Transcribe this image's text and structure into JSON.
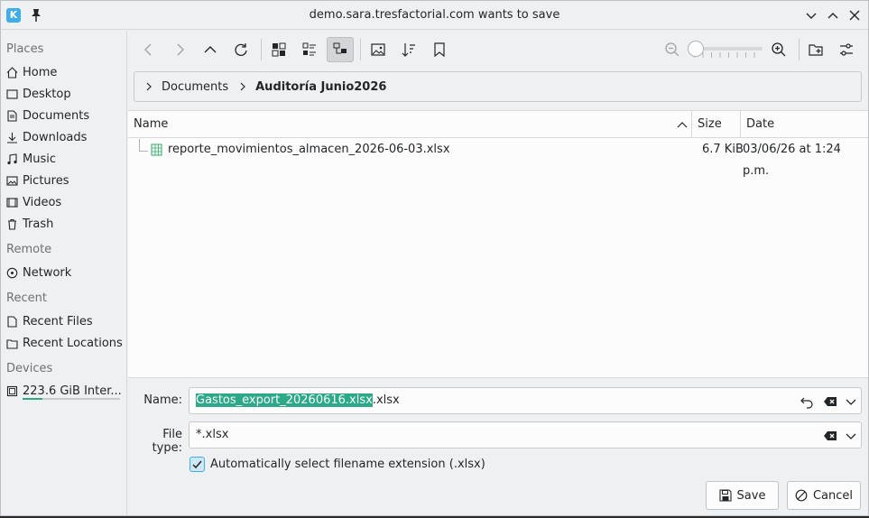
{
  "window": {
    "title": "demo.sara.tresfactorial.com wants to save",
    "app_icon_letter": "K"
  },
  "sidebar": {
    "sections": [
      {
        "title": "Places",
        "items": [
          {
            "label": "Home",
            "icon": "home-icon"
          },
          {
            "label": "Desktop",
            "icon": "desktop-icon"
          },
          {
            "label": "Documents",
            "icon": "documents-icon"
          },
          {
            "label": "Downloads",
            "icon": "downloads-icon"
          },
          {
            "label": "Music",
            "icon": "music-icon"
          },
          {
            "label": "Pictures",
            "icon": "pictures-icon"
          },
          {
            "label": "Videos",
            "icon": "videos-icon"
          },
          {
            "label": "Trash",
            "icon": "trash-icon"
          }
        ]
      },
      {
        "title": "Remote",
        "items": [
          {
            "label": "Network",
            "icon": "network-icon"
          }
        ]
      },
      {
        "title": "Recent",
        "items": [
          {
            "label": "Recent Files",
            "icon": "recent-files-icon"
          },
          {
            "label": "Recent Locations",
            "icon": "recent-locations-icon"
          }
        ]
      },
      {
        "title": "Devices",
        "items": [
          {
            "label": "223.6 GiB Inter...",
            "icon": "drive-icon",
            "usage_fraction": 0.2
          }
        ]
      }
    ]
  },
  "breadcrumb": {
    "items": [
      "Documents",
      "Auditoría Junio2026"
    ]
  },
  "table": {
    "columns": [
      "Name",
      "Size",
      "Date"
    ],
    "rows": [
      {
        "name": "reporte_movimientos_almacen_2026-06-03.xlsx",
        "size": "6.7 KiB",
        "date": "03/06/26 at 1:24 p.m.",
        "icon": "spreadsheet-icon"
      }
    ]
  },
  "form": {
    "name_label": "Name:",
    "name_selected": "Gastos_export_20260616.xlsx",
    "name_rest": ".xlsx",
    "filetype_label": "File type:",
    "filetype_value": "*.xlsx",
    "auto_ext_label": "Automatically select filename extension (.xlsx)",
    "auto_ext_checked": true
  },
  "buttons": {
    "save": "Save",
    "cancel": "Cancel"
  },
  "colors": {
    "accent": "#3daee9",
    "selection": "#2ba989",
    "window_bg": "#eff0f1",
    "view_bg": "#fcfcfc"
  },
  "zoom": {
    "level_fraction": 0.0
  }
}
